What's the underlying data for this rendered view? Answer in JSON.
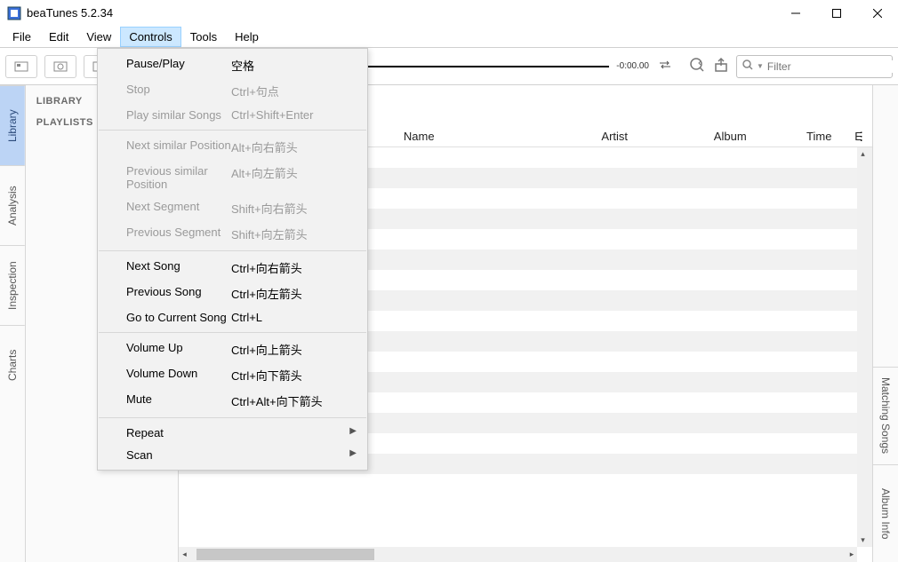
{
  "window": {
    "title": "beaTunes 5.2.34"
  },
  "menubar": [
    "File",
    "Edit",
    "View",
    "Controls",
    "Tools",
    "Help"
  ],
  "menubar_open_index": 3,
  "dropdown": {
    "groups": [
      [
        {
          "label": "Pause/Play",
          "shortcut": "空格",
          "enabled": true
        },
        {
          "label": "Stop",
          "shortcut": "Ctrl+句点",
          "enabled": false
        },
        {
          "label": "Play similar Songs",
          "shortcut": "Ctrl+Shift+Enter",
          "enabled": false
        }
      ],
      [
        {
          "label": "Next similar Position",
          "shortcut": "Alt+向右箭头",
          "enabled": false
        },
        {
          "label": "Previous similar Position",
          "shortcut": "Alt+向左箭头",
          "enabled": false
        },
        {
          "label": "Next Segment",
          "shortcut": "Shift+向右箭头",
          "enabled": false
        },
        {
          "label": "Previous Segment",
          "shortcut": "Shift+向左箭头",
          "enabled": false
        }
      ],
      [
        {
          "label": "Next Song",
          "shortcut": "Ctrl+向右箭头",
          "enabled": true
        },
        {
          "label": "Previous Song",
          "shortcut": "Ctrl+向左箭头",
          "enabled": true
        },
        {
          "label": "Go to Current Song",
          "shortcut": "Ctrl+L",
          "enabled": true
        }
      ],
      [
        {
          "label": "Volume Up",
          "shortcut": "Ctrl+向上箭头",
          "enabled": true
        },
        {
          "label": "Volume Down",
          "shortcut": "Ctrl+向下箭头",
          "enabled": true
        },
        {
          "label": "Mute",
          "shortcut": "Ctrl+Alt+向下箭头",
          "enabled": true
        }
      ],
      [
        {
          "label": "Repeat",
          "shortcut": "",
          "enabled": true,
          "submenu": true
        },
        {
          "label": "Scan",
          "shortcut": "",
          "enabled": true,
          "submenu": true
        }
      ]
    ]
  },
  "toolbar": {
    "time": "-0:00.00",
    "search_placeholder": "Filter"
  },
  "left_tabs": [
    "Library",
    "Analysis",
    "Inspection",
    "Charts"
  ],
  "left_tab_active": 0,
  "sidebar": {
    "items": [
      "LIBRARY",
      "PLAYLISTS"
    ]
  },
  "table": {
    "columns": [
      "Name",
      "Artist",
      "Album",
      "Time",
      "E"
    ]
  },
  "right_tabs": [
    "Matching Songs",
    "Album Info"
  ]
}
